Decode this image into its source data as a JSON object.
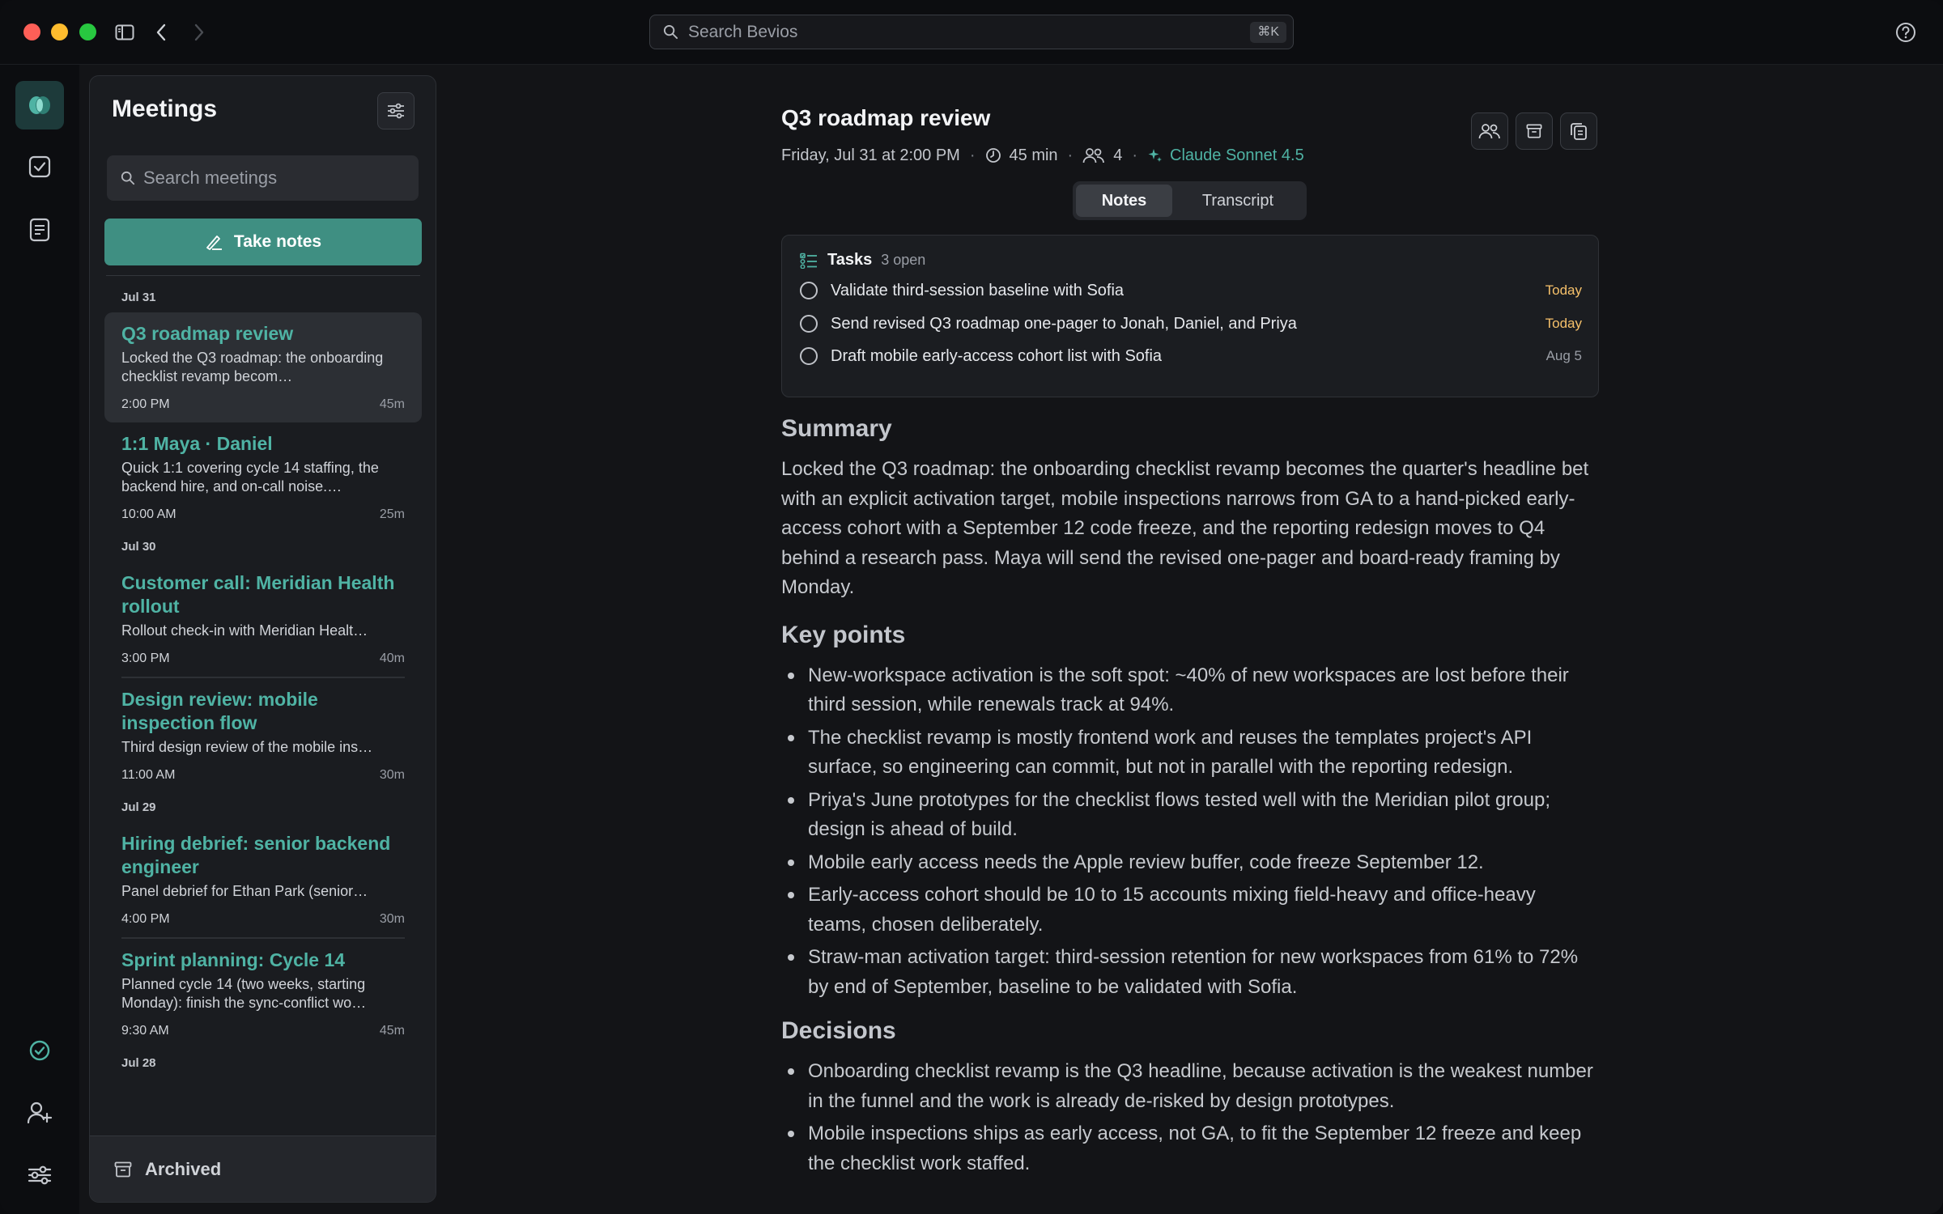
{
  "titlebar": {
    "search_placeholder": "Search Bevios",
    "search_shortcut": "⌘K"
  },
  "sidebar": {
    "title": "Meetings",
    "search_placeholder": "Search meetings",
    "take_notes_label": "Take notes",
    "archived_label": "Archived",
    "groups": [
      {
        "date": "Jul 31",
        "meetings": [
          {
            "title": "Q3 roadmap review",
            "desc": "Locked the Q3 roadmap: the onboarding checklist revamp becom…",
            "time": "2:00 PM",
            "duration": "45m",
            "selected": true
          },
          {
            "title": "1:1 Maya · Daniel",
            "desc": "Quick 1:1 covering cycle 14 staffing, the backend hire, and on-call noise.…",
            "time": "10:00 AM",
            "duration": "25m"
          }
        ]
      },
      {
        "date": "Jul 30",
        "meetings": [
          {
            "title": "Customer call: Meridian Health rollout",
            "desc": "Rollout check-in with Meridian Healt…",
            "time": "3:00 PM",
            "duration": "40m"
          },
          {
            "title": "Design review: mobile inspection flow",
            "desc": "Third design review of the mobile ins…",
            "time": "11:00 AM",
            "duration": "30m"
          }
        ]
      },
      {
        "date": "Jul 29",
        "meetings": [
          {
            "title": "Hiring debrief: senior backend engineer",
            "desc": "Panel debrief for Ethan Park (senior…",
            "time": "4:00 PM",
            "duration": "30m"
          },
          {
            "title": "Sprint planning: Cycle 14",
            "desc": "Planned cycle 14 (two weeks, starting Monday): finish the sync-conflict wo…",
            "time": "9:30 AM",
            "duration": "45m"
          }
        ]
      },
      {
        "date": "Jul 28",
        "meetings": []
      }
    ]
  },
  "main": {
    "title": "Q3 roadmap review",
    "date": "Friday, Jul 31 at 2:00 PM",
    "duration": "45 min",
    "attendees": "4",
    "model": "Claude Sonnet 4.5",
    "tabs": [
      {
        "label": "Notes",
        "active": true
      },
      {
        "label": "Transcript",
        "active": false
      }
    ],
    "tasks": {
      "title": "Tasks",
      "count": "3 open",
      "items": [
        {
          "text": "Validate third-session baseline with Sofia",
          "due": "Today"
        },
        {
          "text": "Send revised Q3 roadmap one-pager to Jonah, Daniel, and Priya",
          "due": "Today"
        },
        {
          "text": "Draft mobile early-access cohort list with Sofia",
          "due": "Aug 5"
        }
      ]
    },
    "summary_heading": "Summary",
    "summary": "Locked the Q3 roadmap: the onboarding checklist revamp becomes the quarter's headline bet with an explicit activation target, mobile inspections narrows from GA to a hand-picked early-access cohort with a September 12 code freeze, and the reporting redesign moves to Q4 behind a research pass. Maya will send the revised one-pager and board-ready framing by Monday.",
    "key_points_heading": "Key points",
    "key_points": [
      "New-workspace activation is the soft spot: ~40% of new workspaces are lost before their third session, while renewals track at 94%.",
      "The checklist revamp is mostly frontend work and reuses the templates project's API surface, so engineering can commit, but not in parallel with the reporting redesign.",
      "Priya's June prototypes for the checklist flows tested well with the Meridian pilot group; design is ahead of build.",
      "Mobile early access needs the Apple review buffer, code freeze September 12.",
      "Early-access cohort should be 10 to 15 accounts mixing field-heavy and office-heavy teams, chosen deliberately.",
      "Straw-man activation target: third-session retention for new workspaces from 61% to 72% by end of September, baseline to be validated with Sofia."
    ],
    "decisions_heading": "Decisions",
    "decisions": [
      "Onboarding checklist revamp is the Q3 headline, because activation is the weakest number in the funnel and the work is already de-risked by design prototypes.",
      "Mobile inspections ships as early access, not GA, to fit the September 12 freeze and keep the checklist work staffed."
    ]
  },
  "colors": {
    "accent": "#4fb3a4",
    "button": "#3f8f82",
    "due_today": "#f5c06a"
  }
}
